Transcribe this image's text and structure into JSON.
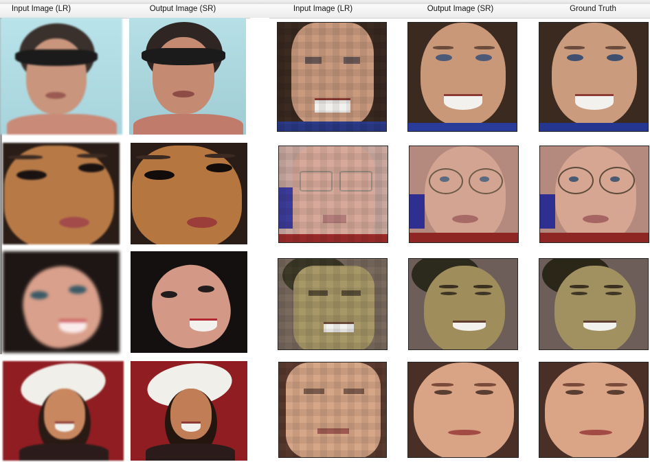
{
  "headers": [
    "Input Image (LR)",
    "Output Image (SR)",
    "Input Image (LR)",
    "Output Image (SR)",
    "Ground Truth"
  ],
  "rows": [
    {
      "subject": "woman-sunglasses",
      "left_tiles": [
        "lr-image",
        "sr-image"
      ],
      "right_tiles": [
        "lr-image",
        "sr-image",
        "ground-truth"
      ]
    },
    {
      "subject": "woman-makeup",
      "left_tiles": [
        "lr-image",
        "sr-image"
      ],
      "right_tiles": [
        "lr-image",
        "sr-image",
        "ground-truth"
      ]
    },
    {
      "subject": "girl-smiling",
      "left_tiles": [
        "lr-image",
        "sr-image"
      ],
      "right_tiles": [
        "lr-image",
        "sr-image",
        "ground-truth"
      ]
    },
    {
      "subject": "woman-white-hat",
      "left_tiles": [
        "lr-image",
        "sr-image"
      ],
      "right_tiles": [
        "lr-image",
        "sr-image",
        "ground-truth"
      ]
    }
  ],
  "colors": {
    "hat_background": "#8f1d22",
    "header_background": "#f4f4f4",
    "tile_border": "#222222"
  }
}
